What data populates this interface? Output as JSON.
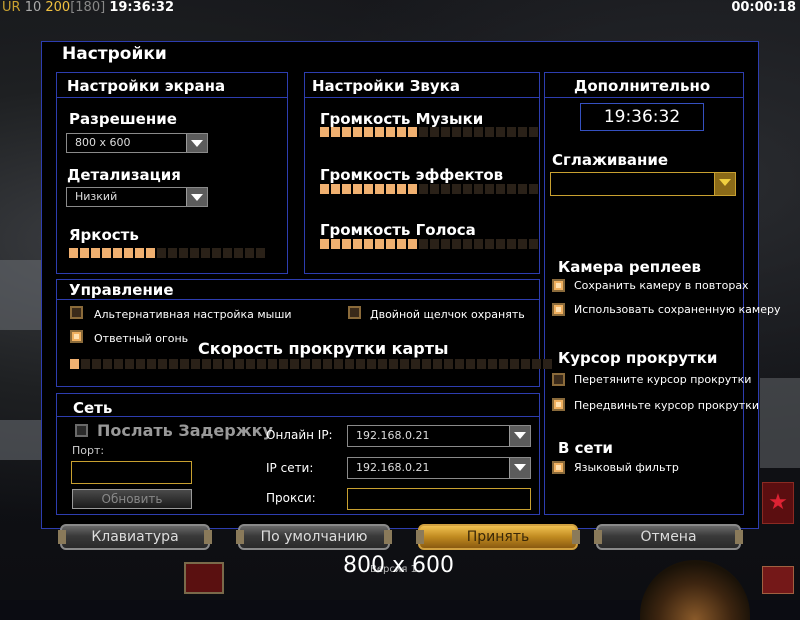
{
  "topbar": {
    "ur": "UR",
    "n1": "10",
    "n2": "200",
    "n3": "[180]",
    "clock": "19:36:32",
    "elapsed": "00:00:18"
  },
  "dialog": {
    "title": "Настройки"
  },
  "screen": {
    "title": "Настройки экрана",
    "resolution_label": "Разрешение",
    "resolution_value": "800 x 600",
    "detail_label": "Детализация",
    "detail_value": "Низкий",
    "brightness_label": "Яркость",
    "brightness_level": 8,
    "brightness_segments": 18
  },
  "sound": {
    "title": "Настройки Звука",
    "music_label": "Громкость Музыки",
    "music_level": 9,
    "effects_label": "Громкость эффектов",
    "effects_level": 9,
    "voice_label": "Громкость Голоса",
    "voice_level": 9,
    "segments": 20
  },
  "extra": {
    "title": "Дополнительно",
    "clock": "19:36:32",
    "antialias_label": "Сглаживание",
    "antialias_value": "",
    "replay_camera_title": "Камера реплеев",
    "save_camera": "Сохранить камеру в повторах",
    "save_camera_checked": true,
    "use_saved_camera": "Использовать сохраненную камеру",
    "use_saved_camera_checked": true,
    "scroll_cursor_title": "Курсор прокрутки",
    "drag_cursor": "Перетяните курсор прокрутки",
    "drag_cursor_checked": false,
    "move_cursor": "Передвиньте курсор прокрутки",
    "move_cursor_checked": true,
    "online_title": "В сети",
    "lang_filter": "Языковый фильтр",
    "lang_filter_checked": true
  },
  "control": {
    "title": "Управление",
    "alt_mouse": "Альтернативная настройка мыши",
    "alt_mouse_checked": false,
    "double_click": "Двойной щелчок охранять",
    "double_click_checked": false,
    "return_fire": "Ответный огонь",
    "return_fire_checked": true,
    "scroll_speed_label": "Скорость прокрутки карты",
    "scroll_speed_level": 1,
    "scroll_speed_segments": 44
  },
  "network": {
    "title": "Сеть",
    "send_delay": "Послать Задержку",
    "port_label": "Порт:",
    "port_value": "",
    "refresh": "Обновить",
    "online_ip_label": "Онлайн IP:",
    "online_ip_value": "192.168.0.21",
    "net_ip_label": "IP сети:",
    "net_ip_value": "192.168.0.21",
    "proxy_label": "Прокси:",
    "proxy_value": ""
  },
  "buttons": {
    "keyboard": "Клавиатура",
    "defaults": "По умолчанию",
    "accept": "Принять",
    "cancel": "Отмена"
  },
  "footer": {
    "resolution": "800 x 600",
    "version": "Версия 1.."
  }
}
